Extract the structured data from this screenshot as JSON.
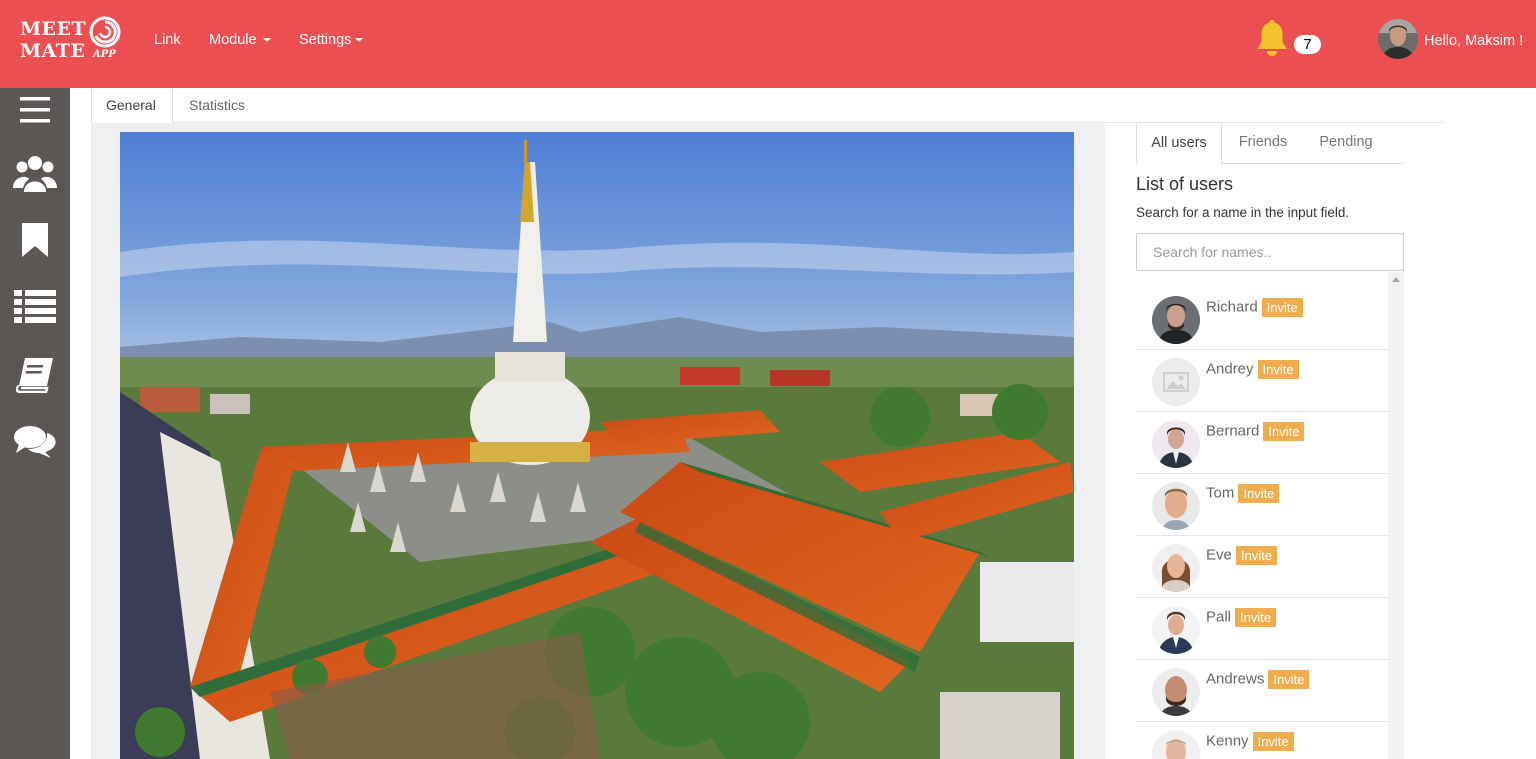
{
  "brand": {
    "line1": "MEET",
    "line2": "MATE",
    "line3": "APP"
  },
  "nav": {
    "link": "Link",
    "module": "Module",
    "settings": "Settings"
  },
  "notifications": {
    "count": "7"
  },
  "user": {
    "greeting": "Hello, Maksim !"
  },
  "sidebar": {
    "icons": [
      "menu-icon",
      "users-icon",
      "bookmark-icon",
      "list-icon",
      "book-icon",
      "chat-icon"
    ]
  },
  "main": {
    "tabs": [
      "General",
      "Statistics"
    ],
    "active_tab": "General"
  },
  "right_panel": {
    "tabs": [
      "All users",
      "Friends",
      "Pending"
    ],
    "active_tab": "All users",
    "title": "List of users",
    "subtitle": "Search for a name in the input field.",
    "search_placeholder": "Search for names..",
    "invite_label": "Invite",
    "users": [
      {
        "name": "Richard"
      },
      {
        "name": "Andrey"
      },
      {
        "name": "Bernard"
      },
      {
        "name": "Tom"
      },
      {
        "name": "Eve"
      },
      {
        "name": "Pall"
      },
      {
        "name": "Andrews"
      },
      {
        "name": "Kenny"
      }
    ]
  },
  "colors": {
    "navbar": "#eb4f52",
    "sidebar": "#5c5654",
    "invite": "#f0ad4e",
    "bell": "#f2c12e"
  }
}
